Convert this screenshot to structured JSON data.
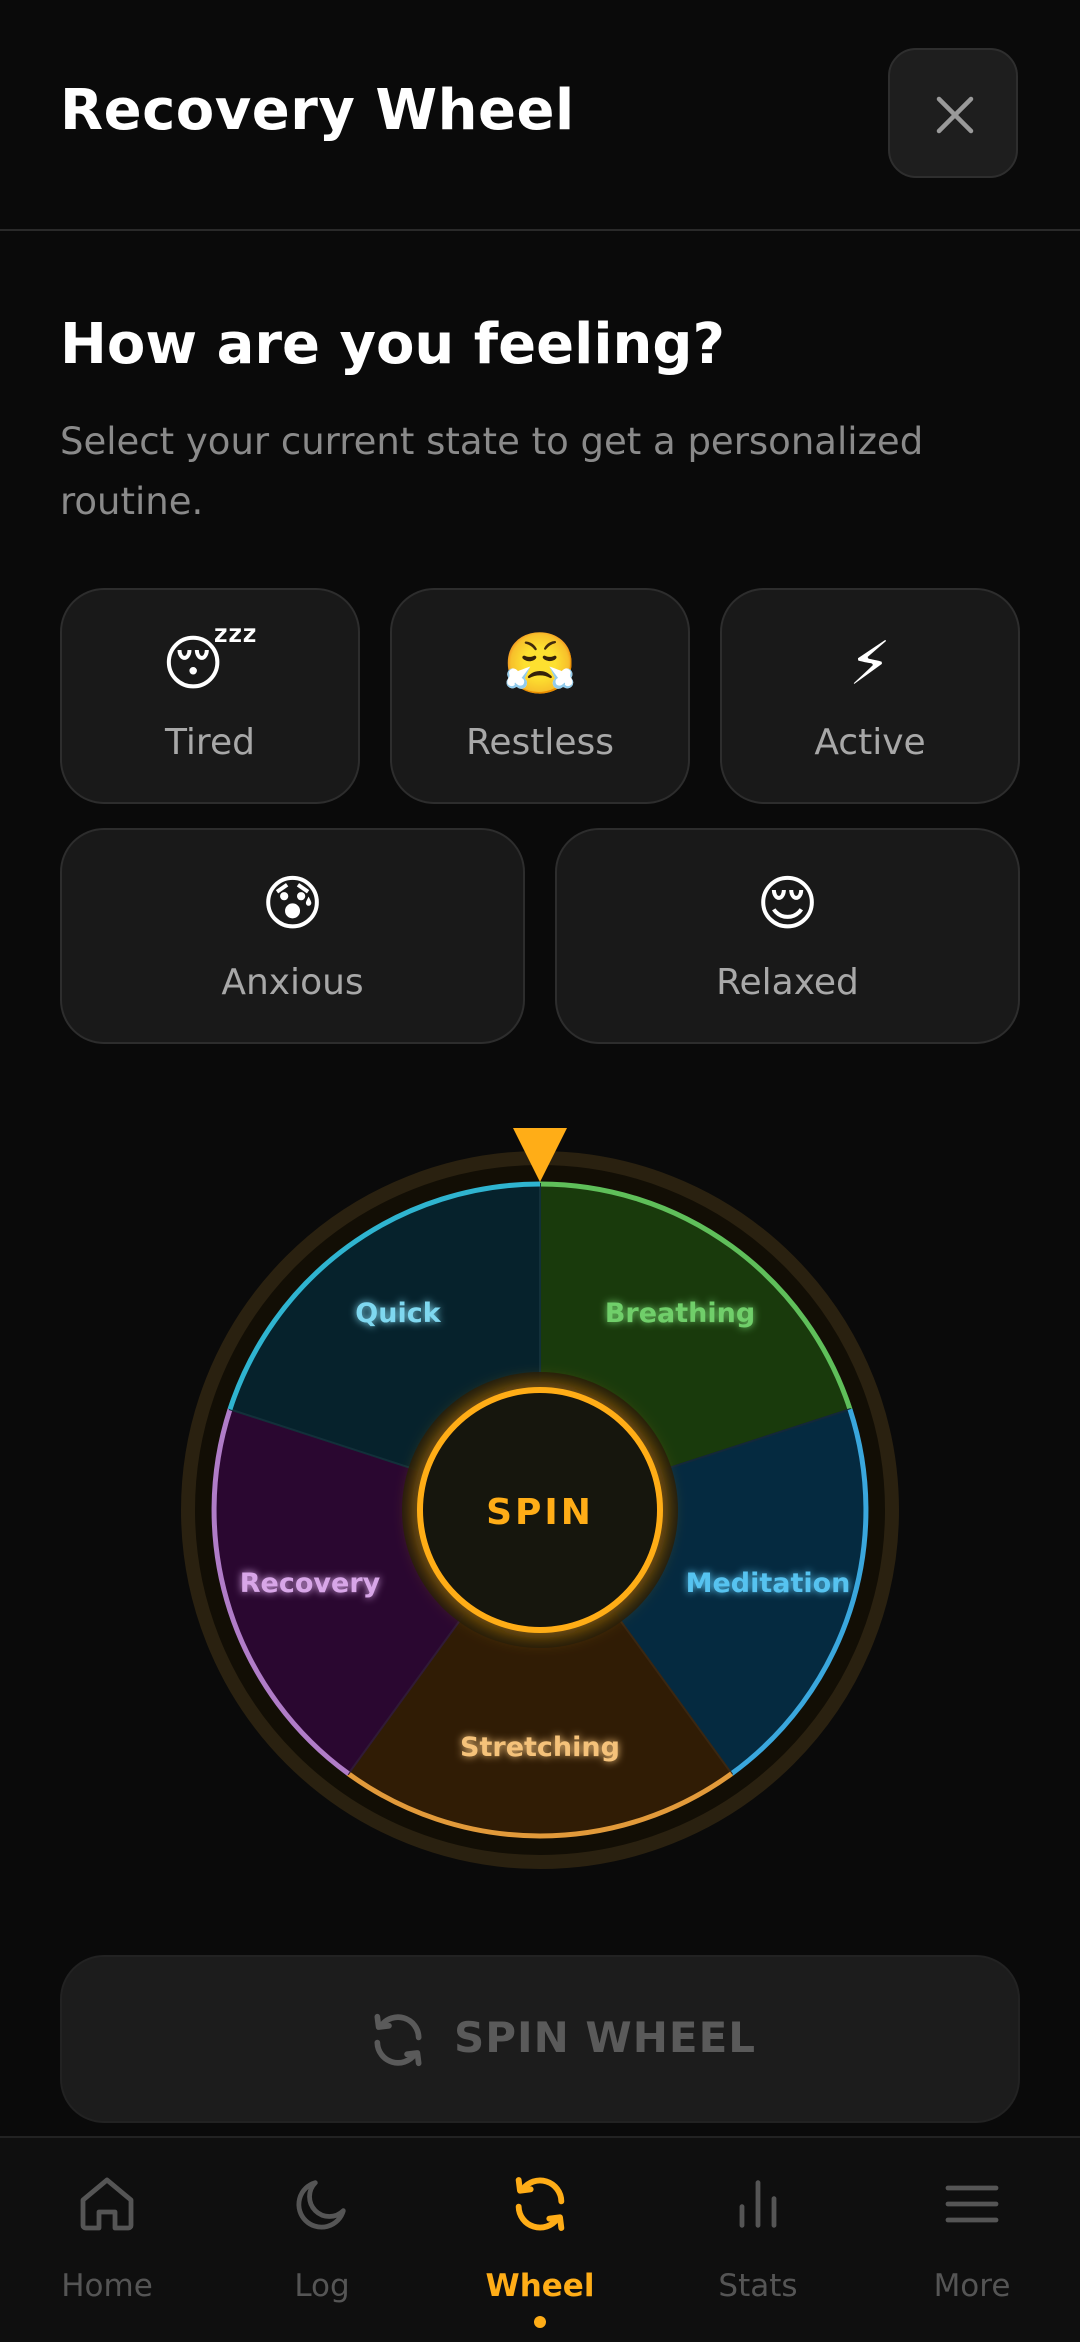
{
  "header": {
    "title": "Recovery Wheel"
  },
  "prompt": {
    "title": "How are you feeling?",
    "subtitle": "Select your current state to get a personalized routine."
  },
  "moods": [
    {
      "label": "Tired",
      "emoji": "😴"
    },
    {
      "label": "Restless",
      "emoji": "😤"
    },
    {
      "label": "Active",
      "emoji": "⚡"
    },
    {
      "label": "Anxious",
      "emoji": "😰"
    },
    {
      "label": "Relaxed",
      "emoji": "😌"
    }
  ],
  "wheel": {
    "center_label": "SPIN",
    "segments": [
      {
        "label": "Breathing",
        "color": "#6fcf6a"
      },
      {
        "label": "Meditation",
        "color": "#57c3f0"
      },
      {
        "label": "Stretching",
        "color": "#f5c27a"
      },
      {
        "label": "Recovery",
        "color": "#d8a6e8"
      },
      {
        "label": "Quick",
        "color": "#7fd8f0"
      }
    ],
    "accent_color": "#ffad17"
  },
  "cta": {
    "label": "SPIN WHEEL"
  },
  "nav": {
    "items": [
      {
        "label": "Home",
        "icon": "home-icon"
      },
      {
        "label": "Log",
        "icon": "moon-icon"
      },
      {
        "label": "Wheel",
        "icon": "refresh-icon"
      },
      {
        "label": "Stats",
        "icon": "bar-chart-icon"
      },
      {
        "label": "More",
        "icon": "menu-icon"
      }
    ],
    "active": "Wheel"
  }
}
